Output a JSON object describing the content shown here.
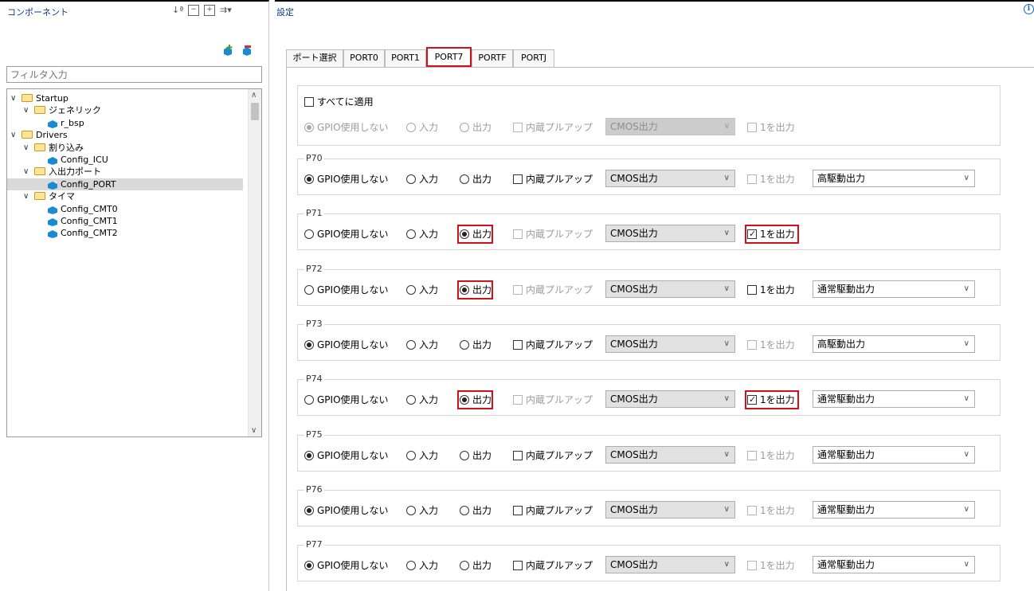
{
  "left_panel": {
    "title": "コンポーネント",
    "filter_placeholder": "フィルタ入力",
    "tree": [
      {
        "label": "Startup",
        "type": "folder",
        "level": 0
      },
      {
        "label": "ジェネリック",
        "type": "folder",
        "level": 1
      },
      {
        "label": "r_bsp",
        "type": "config",
        "level": 2
      },
      {
        "label": "Drivers",
        "type": "folder",
        "level": 0
      },
      {
        "label": "割り込み",
        "type": "folder",
        "level": 1
      },
      {
        "label": "Config_ICU",
        "type": "config",
        "level": 2
      },
      {
        "label": "入出力ポート",
        "type": "folder",
        "level": 1
      },
      {
        "label": "Config_PORT",
        "type": "config",
        "level": 2,
        "selected": true
      },
      {
        "label": "タイマ",
        "type": "folder",
        "level": 1
      },
      {
        "label": "Config_CMT0",
        "type": "config",
        "level": 2
      },
      {
        "label": "Config_CMT1",
        "type": "config",
        "level": 2
      },
      {
        "label": "Config_CMT2",
        "type": "config",
        "level": 2
      }
    ]
  },
  "right_panel": {
    "title": "設定",
    "tabs": [
      "ポート選択",
      "PORT0",
      "PORT1",
      "PORT7",
      "PORTF",
      "PORTJ"
    ],
    "active_tab": "PORT7",
    "apply_all": {
      "label": "すべてに適用",
      "checked": false,
      "options": {
        "gpio_unused": "GPIO使用しない",
        "input": "入力",
        "output": "出力",
        "pullup": "内蔵プルアップ",
        "mode": "CMOS出力",
        "output1": "1を出力"
      }
    },
    "pins": [
      {
        "name": "P70",
        "gpio_unused": "GPIO使用しない",
        "input": "入力",
        "output": "出力",
        "pullup": "内蔵プルアップ",
        "mode": "CMOS出力",
        "output1": "1を出力",
        "drive": "高駆動出力"
      },
      {
        "name": "P71",
        "gpio_unused": "GPIO使用しない",
        "input": "入力",
        "output": "出力",
        "pullup": "内蔵プルアップ",
        "mode": "CMOS出力",
        "output1": "1を出力",
        "drive": ""
      },
      {
        "name": "P72",
        "gpio_unused": "GPIO使用しない",
        "input": "入力",
        "output": "出力",
        "pullup": "内蔵プルアップ",
        "mode": "CMOS出力",
        "output1": "1を出力",
        "drive": "通常駆動出力"
      },
      {
        "name": "P73",
        "gpio_unused": "GPIO使用しない",
        "input": "入力",
        "output": "出力",
        "pullup": "内蔵プルアップ",
        "mode": "CMOS出力",
        "output1": "1を出力",
        "drive": "高駆動出力"
      },
      {
        "name": "P74",
        "gpio_unused": "GPIO使用しない",
        "input": "入力",
        "output": "出力",
        "pullup": "内蔵プルアップ",
        "mode": "CMOS出力",
        "output1": "1を出力",
        "drive": "通常駆動出力"
      },
      {
        "name": "P75",
        "gpio_unused": "GPIO使用しない",
        "input": "入力",
        "output": "出力",
        "pullup": "内蔵プルアップ",
        "mode": "CMOS出力",
        "output1": "1を出力",
        "drive": "通常駆動出力"
      },
      {
        "name": "P76",
        "gpio_unused": "GPIO使用しない",
        "input": "入力",
        "output": "出力",
        "pullup": "内蔵プルアップ",
        "mode": "CMOS出力",
        "output1": "1を出力",
        "drive": "通常駆動出力"
      },
      {
        "name": "P77",
        "gpio_unused": "GPIO使用しない",
        "input": "入力",
        "output": "出力",
        "pullup": "内蔵プルアップ",
        "mode": "CMOS出力",
        "output1": "1を出力",
        "drive": "通常駆動出力"
      }
    ]
  },
  "colors": {
    "highlight": "#d0101b",
    "title_blue": "#0b3a8c",
    "selected_row": "#d9d9d9"
  }
}
